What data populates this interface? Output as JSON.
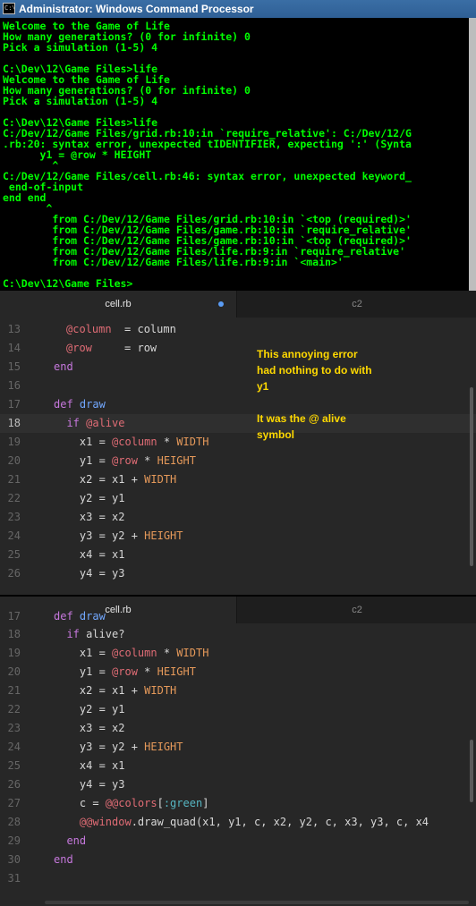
{
  "console": {
    "title": "Administrator: Windows Command Processor",
    "lines": [
      "Welcome to the Game of Life",
      "How many generations? (0 for infinite) 0",
      "Pick a simulation (1-5) 4",
      "",
      "C:\\Dev\\12\\Game Files>life",
      "Welcome to the Game of Life",
      "How many generations? (0 for infinite) 0",
      "Pick a simulation (1-5) 4",
      "",
      "C:\\Dev\\12\\Game Files>life",
      "C:/Dev/12/Game Files/grid.rb:10:in `require_relative': C:/Dev/12/G",
      ".rb:20: syntax error, unexpected tIDENTIFIER, expecting ':' (Synta",
      "      y1 = @row * HEIGHT",
      "        ^",
      "C:/Dev/12/Game Files/cell.rb:46: syntax error, unexpected keyword_",
      " end-of-input",
      "end end",
      "       ^",
      "        from C:/Dev/12/Game Files/grid.rb:10:in `<top (required)>'",
      "        from C:/Dev/12/Game Files/game.rb:10:in `require_relative'",
      "        from C:/Dev/12/Game Files/game.rb:10:in `<top (required)>'",
      "        from C:/Dev/12/Game Files/life.rb:9:in `require_relative'",
      "        from C:/Dev/12/Game Files/life.rb:9:in `<main>'",
      "",
      "C:\\Dev\\12\\Game Files>"
    ]
  },
  "editor_top": {
    "tabs": [
      {
        "label": "cell.rb",
        "modified": true
      },
      {
        "label": "c2"
      }
    ],
    "lines": [
      {
        "num": "13",
        "parts": [
          {
            "t": "@column",
            "c": "ivar"
          },
          {
            "t": "  = column",
            "c": "txt"
          }
        ]
      },
      {
        "num": "14",
        "parts": [
          {
            "t": "@row",
            "c": "ivar"
          },
          {
            "t": "     = row",
            "c": "txt"
          }
        ]
      },
      {
        "num": "15",
        "parts": [
          {
            "t": "end",
            "c": "kw",
            "indent": 0
          }
        ]
      },
      {
        "num": "16",
        "parts": []
      },
      {
        "num": "17",
        "parts": [
          {
            "t": "def ",
            "c": "kw"
          },
          {
            "t": "draw",
            "c": "fn"
          }
        ]
      },
      {
        "num": "18",
        "parts": [
          {
            "t": "  if ",
            "c": "kw"
          },
          {
            "t": "@alive",
            "c": "ivar"
          }
        ]
      },
      {
        "num": "19",
        "parts": [
          {
            "t": "    x1 = ",
            "c": "txt"
          },
          {
            "t": "@column",
            "c": "ivar"
          },
          {
            "t": " * ",
            "c": "txt"
          },
          {
            "t": "WIDTH",
            "c": "const"
          }
        ]
      },
      {
        "num": "20",
        "parts": [
          {
            "t": "    y1 = ",
            "c": "txt"
          },
          {
            "t": "@row",
            "c": "ivar"
          },
          {
            "t": " * ",
            "c": "txt"
          },
          {
            "t": "HEIGHT",
            "c": "const"
          }
        ]
      },
      {
        "num": "21",
        "parts": [
          {
            "t": "    x2 = x1 + ",
            "c": "txt"
          },
          {
            "t": "WIDTH",
            "c": "const"
          }
        ]
      },
      {
        "num": "22",
        "parts": [
          {
            "t": "    y2 = y1",
            "c": "txt"
          }
        ]
      },
      {
        "num": "23",
        "parts": [
          {
            "t": "    x3 = x2",
            "c": "txt"
          }
        ]
      },
      {
        "num": "24",
        "parts": [
          {
            "t": "    y3 = y2 + ",
            "c": "txt"
          },
          {
            "t": "HEIGHT",
            "c": "const"
          }
        ]
      },
      {
        "num": "25",
        "parts": [
          {
            "t": "    x4 = x1",
            "c": "txt"
          }
        ]
      },
      {
        "num": "26",
        "parts": [
          {
            "t": "    y4 = y3",
            "c": "txt"
          }
        ]
      }
    ],
    "annotation": {
      "line1": "This annoying error",
      "line2": "had nothing to do with",
      "line3": "y1",
      "line4": "It was the @ alive",
      "line5": "symbol"
    }
  },
  "editor_bottom": {
    "tabs": [
      {
        "label": "cell.rb",
        "modified": false
      },
      {
        "label": "c2"
      }
    ],
    "lines": [
      {
        "num": "18",
        "parts": [
          {
            "t": "  if ",
            "c": "kw"
          },
          {
            "t": "alive?",
            "c": "txt"
          }
        ]
      },
      {
        "num": "19",
        "parts": [
          {
            "t": "    x1 = ",
            "c": "txt"
          },
          {
            "t": "@column",
            "c": "ivar"
          },
          {
            "t": " * ",
            "c": "txt"
          },
          {
            "t": "WIDTH",
            "c": "const"
          }
        ]
      },
      {
        "num": "20",
        "parts": [
          {
            "t": "    y1 = ",
            "c": "txt"
          },
          {
            "t": "@row",
            "c": "ivar"
          },
          {
            "t": " * ",
            "c": "txt"
          },
          {
            "t": "HEIGHT",
            "c": "const"
          }
        ]
      },
      {
        "num": "21",
        "parts": [
          {
            "t": "    x2 = x1 + ",
            "c": "txt"
          },
          {
            "t": "WIDTH",
            "c": "const"
          }
        ]
      },
      {
        "num": "22",
        "parts": [
          {
            "t": "    y2 = y1",
            "c": "txt"
          }
        ]
      },
      {
        "num": "23",
        "parts": [
          {
            "t": "    x3 = x2",
            "c": "txt"
          }
        ]
      },
      {
        "num": "24",
        "parts": [
          {
            "t": "    y3 = y2 + ",
            "c": "txt"
          },
          {
            "t": "HEIGHT",
            "c": "const"
          }
        ]
      },
      {
        "num": "25",
        "parts": [
          {
            "t": "    x4 = x1",
            "c": "txt"
          }
        ]
      },
      {
        "num": "26",
        "parts": [
          {
            "t": "    y4 = y3",
            "c": "txt"
          }
        ]
      },
      {
        "num": "27",
        "parts": [
          {
            "t": "    c = ",
            "c": "txt"
          },
          {
            "t": "@@colors",
            "c": "ivar"
          },
          {
            "t": "[",
            "c": "txt"
          },
          {
            "t": ":green",
            "c": "sym"
          },
          {
            "t": "]",
            "c": "txt"
          }
        ]
      },
      {
        "num": "28",
        "parts": [
          {
            "t": "    ",
            "c": "txt"
          },
          {
            "t": "@@window",
            "c": "ivar"
          },
          {
            "t": ".draw_quad(x1, y1, c, x2, y2, c, x3, y3, c, x4",
            "c": "txt"
          }
        ]
      },
      {
        "num": "29",
        "parts": [
          {
            "t": "  end",
            "c": "kw"
          }
        ]
      },
      {
        "num": "30",
        "parts": [
          {
            "t": "end",
            "c": "kw"
          }
        ]
      },
      {
        "num": "31",
        "parts": []
      }
    ],
    "partial_top_line": {
      "num": "17",
      "parts": [
        {
          "t": "def ",
          "c": "kw"
        },
        {
          "t": "draw",
          "c": "fn"
        }
      ]
    }
  }
}
